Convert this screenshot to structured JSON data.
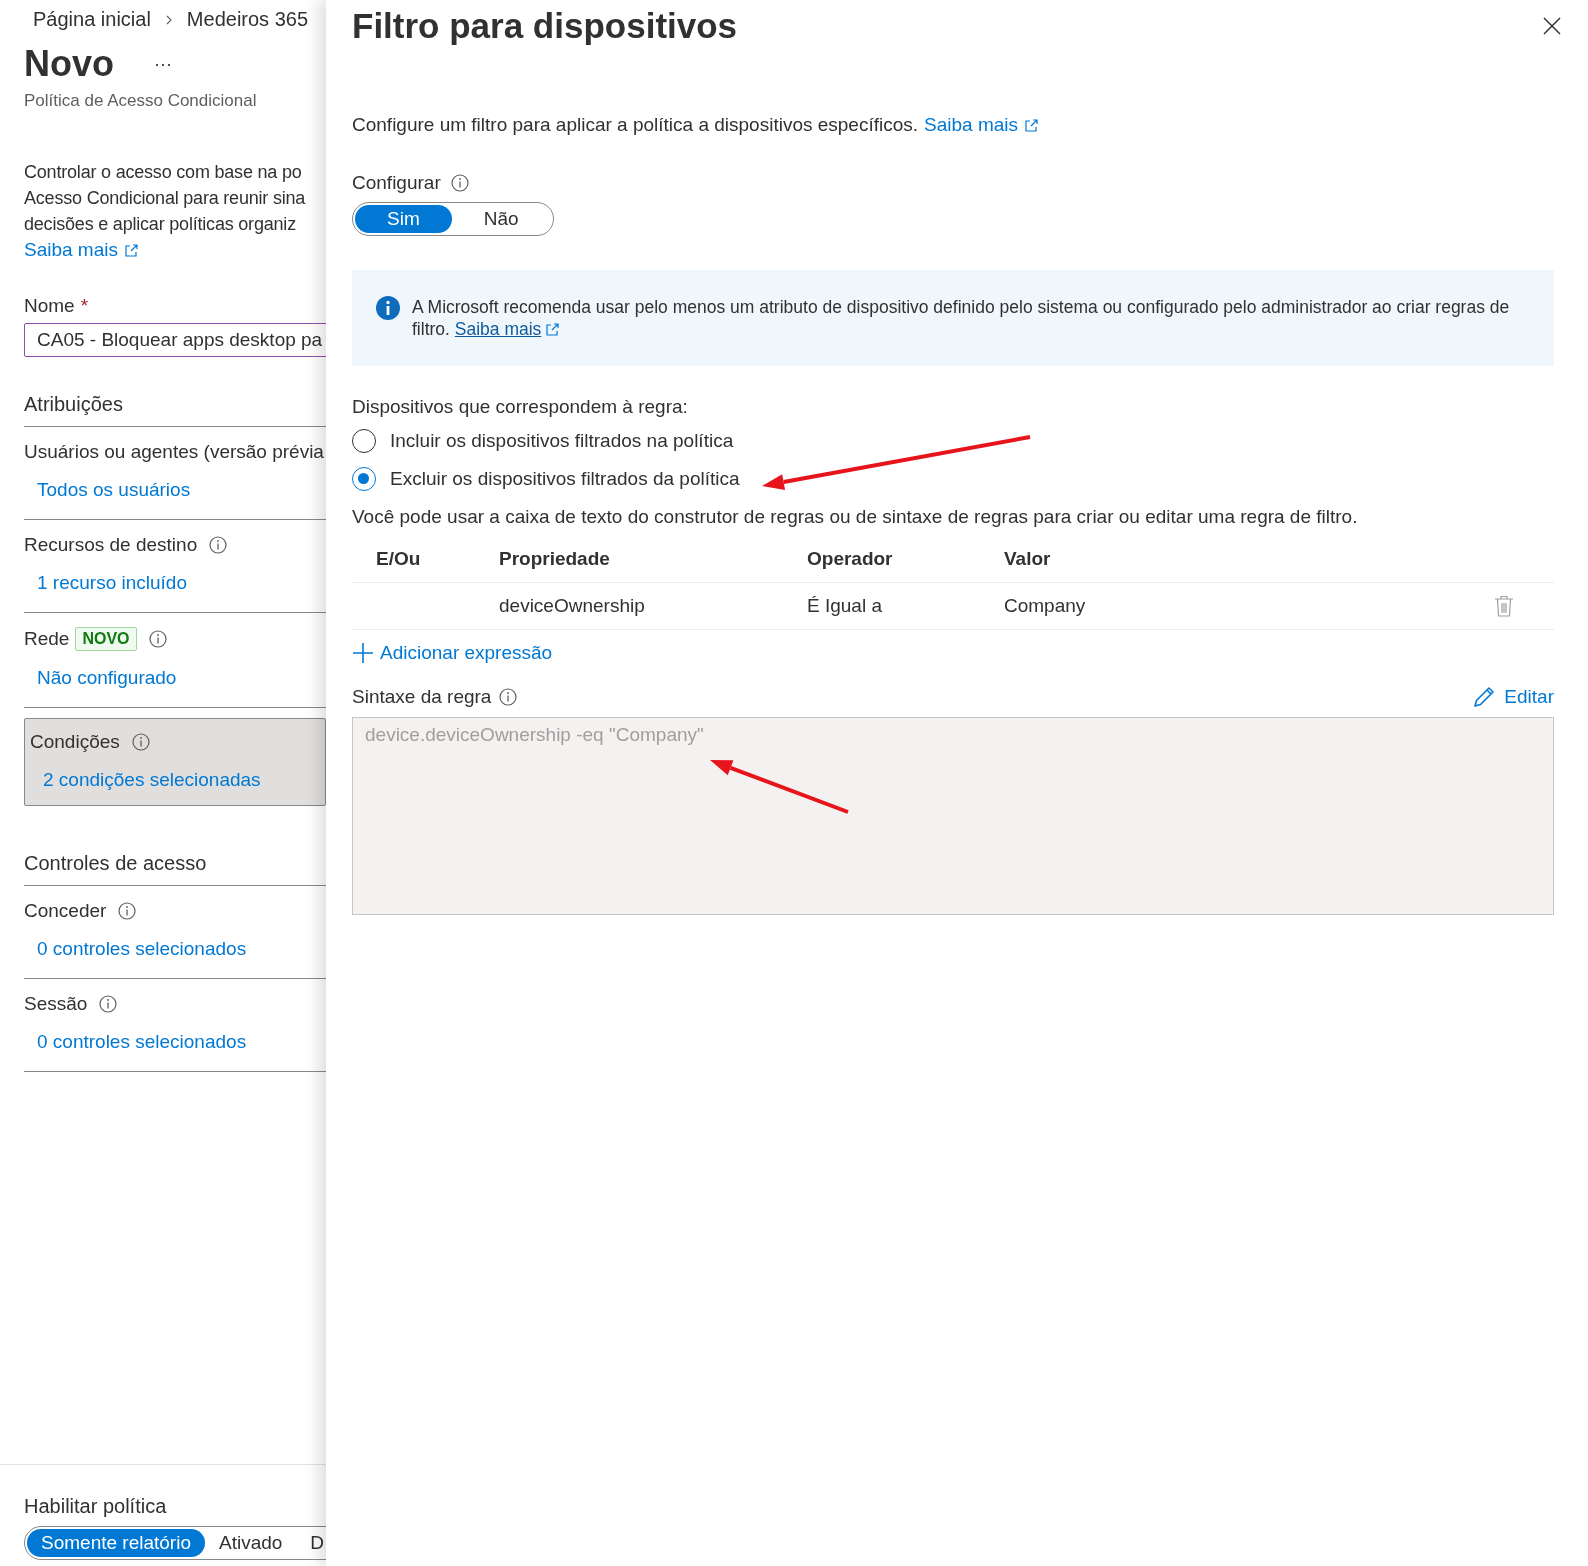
{
  "breadcrumb": [
    {
      "label": "Página inicial"
    },
    {
      "label": "Medeiros 365"
    }
  ],
  "blade": {
    "title": "Novo",
    "more": "···",
    "subtitle": "Política de Acesso Condicional",
    "description": "Controlar o acesso com base na po\nAcesso Condicional para reunir sina\ndecisões e aplicar políticas organiz",
    "learn_more": "Saiba mais",
    "name_field": {
      "label": "Nome",
      "required_mark": "*",
      "value": "CA05 - Bloquear apps desktop pa"
    },
    "sections": [
      {
        "title": "Atribuições",
        "items": [
          {
            "label": "Usuários ou agentes (versão prévia",
            "value": "Todos os usuários",
            "selected": false
          },
          {
            "label": "Recursos de destino",
            "info": true,
            "value": "1 recurso incluído",
            "selected": false
          },
          {
            "label": "Rede",
            "badge": "NOVO",
            "info": true,
            "value": "Não configurado",
            "selected": false
          },
          {
            "label": "Condições",
            "info": true,
            "value": "2 condições selecionadas",
            "selected": true
          }
        ]
      },
      {
        "title": "Controles de acesso",
        "items": [
          {
            "label": "Conceder",
            "info": true,
            "value": "0 controles selecionados",
            "selected": false
          },
          {
            "label": "Sessão",
            "info": true,
            "value": "0 controles selecionados",
            "selected": false
          }
        ]
      }
    ],
    "enable_policy": {
      "label": "Habilitar política",
      "options": [
        {
          "label": "Somente relatório",
          "selected": true
        },
        {
          "label": "Ativado",
          "selected": false
        },
        {
          "label": "D",
          "selected": false
        }
      ]
    }
  },
  "panel": {
    "title": "Filtro para dispositivos",
    "description": "Configure um filtro para aplicar a política a dispositivos específicos.",
    "learn_more": "Saiba mais",
    "configure": {
      "label": "Configurar",
      "info": true,
      "options": [
        {
          "label": "Sim",
          "selected": true
        },
        {
          "label": "Não",
          "selected": false
        }
      ]
    },
    "info_banner": {
      "text": "A Microsoft recomenda usar pelo menos um atributo de dispositivo definido pelo sistema ou configurado pelo administrador ao criar regras de filtro.",
      "link": "Saiba mais"
    },
    "devices_rule": {
      "label": "Dispositivos que correspondem à regra:",
      "options": [
        {
          "label": "Incluir os dispositivos filtrados na política",
          "selected": false
        },
        {
          "label": "Excluir os dispositivos filtrados da política",
          "selected": true
        }
      ]
    },
    "hint": "Você pode usar a caixa de texto do construtor de regras ou de sintaxe de regras para criar ou editar uma regra de filtro.",
    "table": {
      "columns": [
        "E/Ou",
        "Propriedade",
        "Operador",
        "Valor"
      ],
      "rows": [
        {
          "property": "deviceOwnership",
          "operator": "É Igual a",
          "value": "Company"
        }
      ]
    },
    "add_expression": "Adicionar expressão",
    "rule_syntax": {
      "label": "Sintaxe da regra",
      "info": true,
      "edit": "Editar",
      "value": "device.deviceOwnership -eq \"Company\"",
      "disabled": true
    }
  },
  "annotations": [
    {
      "kind": "arrow",
      "color": "#e8141c"
    },
    {
      "kind": "arrow",
      "color": "#e8141c"
    }
  ]
}
